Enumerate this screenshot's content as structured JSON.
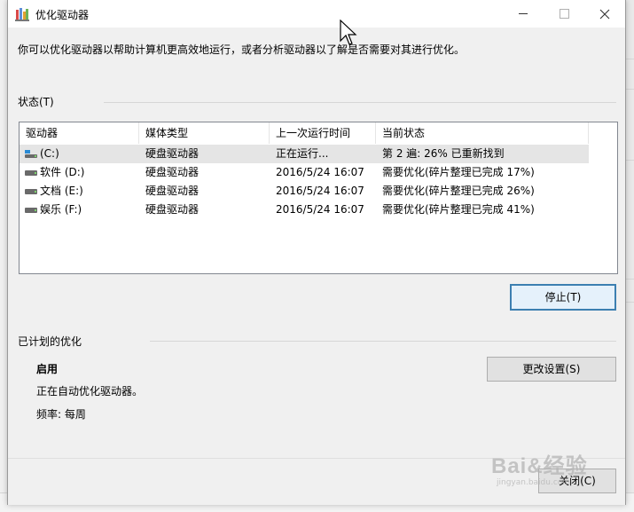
{
  "window": {
    "title": "优化驱动器",
    "description": "你可以优化驱动器以帮助计算机更高效地运行，或者分析驱动器以了解是否需要对其进行优化。"
  },
  "status_section": {
    "label": "状态(T)",
    "columns": [
      "驱动器",
      "媒体类型",
      "上一次运行时间",
      "当前状态"
    ],
    "drives": [
      {
        "name": "(C:)",
        "media": "硬盘驱动器",
        "last_run": "正在运行...",
        "status": "第 2 遍: 26% 已重新找到",
        "icon": "system-drive-icon",
        "selected": true
      },
      {
        "name": "软件 (D:)",
        "media": "硬盘驱动器",
        "last_run": "2016/5/24 16:07",
        "status": "需要优化(碎片整理已完成 17%)",
        "icon": "hard-drive-icon",
        "selected": false
      },
      {
        "name": "文档 (E:)",
        "media": "硬盘驱动器",
        "last_run": "2016/5/24 16:07",
        "status": "需要优化(碎片整理已完成 26%)",
        "icon": "hard-drive-icon",
        "selected": false
      },
      {
        "name": "娱乐 (F:)",
        "media": "硬盘驱动器",
        "last_run": "2016/5/24 16:07",
        "status": "需要优化(碎片整理已完成 41%)",
        "icon": "hard-drive-icon",
        "selected": false
      }
    ],
    "stop_button": "停止(T)"
  },
  "scheduled_section": {
    "label": "已计划的优化",
    "status": "启用",
    "detail": "正在自动优化驱动器。",
    "frequency": "频率: 每周",
    "change_settings_button": "更改设置(S)"
  },
  "footer": {
    "close_button": "关闭(C)"
  },
  "watermark": {
    "main": "Bai&经验",
    "sub": "jingyan.baidu.com"
  },
  "colors": {
    "focus_border": "#3c7fb1",
    "selected_row": "#e5e5e5"
  }
}
